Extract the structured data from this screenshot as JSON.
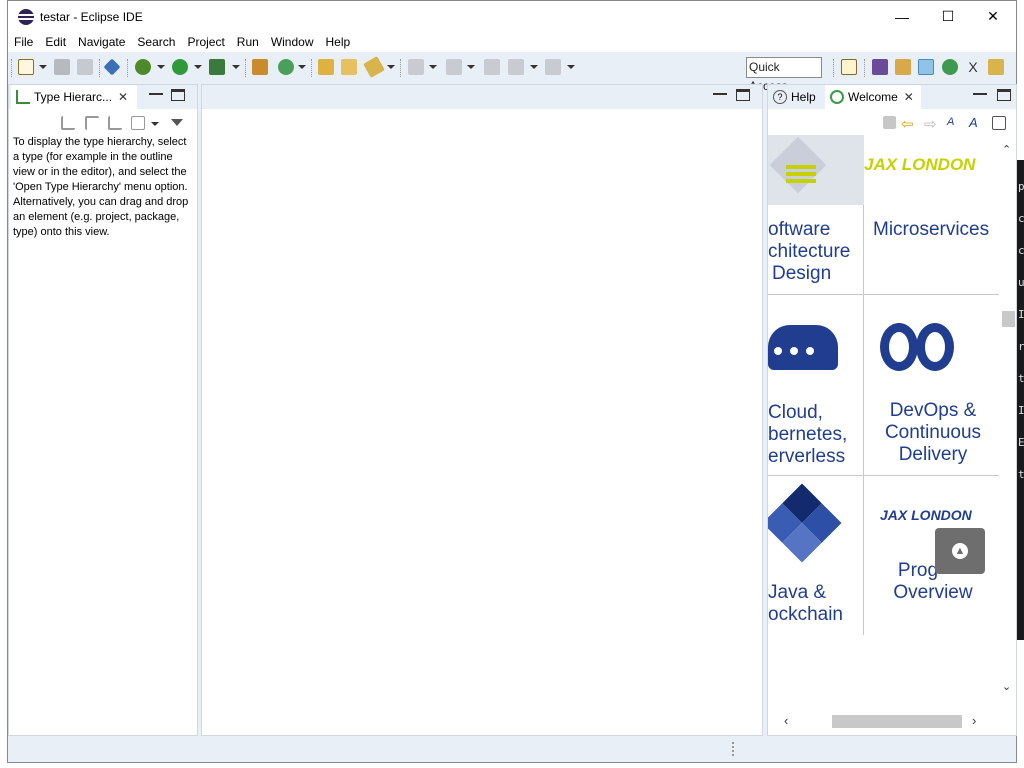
{
  "window": {
    "title": "testar - Eclipse IDE",
    "minimize": "—",
    "maximize": "☐",
    "close": "✕"
  },
  "menu": [
    "File",
    "Edit",
    "Navigate",
    "Search",
    "Project",
    "Run",
    "Window",
    "Help"
  ],
  "toolbar": {
    "quick_access": "Quick Access"
  },
  "left_panel": {
    "tab_label": "Type Hierarc...",
    "body_text": "To display the type hierarchy, select a type (for example in the outline view or in the editor), and select the 'Open Type Hierarchy' menu option. Alternatively, you can drag and drop an element (e.g. project, package, type) onto this view."
  },
  "right_panel": {
    "tabs": [
      "Help",
      "Welcome"
    ],
    "welcome": {
      "logo_text": "JAX LONDON",
      "tiles": {
        "arch_line1": "oftware",
        "arch_line2": "chitecture",
        "arch_line3": "Design",
        "micro": "Microservices",
        "cloud_line1": "Cloud,",
        "cloud_line2": "bernetes,",
        "cloud_line3": "erverless",
        "devops_line1": "DevOps &",
        "devops_line2": "Continuous",
        "devops_line3": "Delivery",
        "java_line1": "Java &",
        "java_line2": "ockchain",
        "prog_line1": "Prog",
        "prog_line2": "Overview",
        "small_logo": "JAX LONDON"
      }
    }
  },
  "background_terminal_chars": [
    "p",
    "c",
    "c",
    "u",
    "I",
    "r",
    "t",
    "I",
    "E",
    "t"
  ],
  "colors": {
    "accent_blue": "#203d8f",
    "jax_lime": "#c5d200",
    "eclipse_bg": "#e9eff7"
  }
}
